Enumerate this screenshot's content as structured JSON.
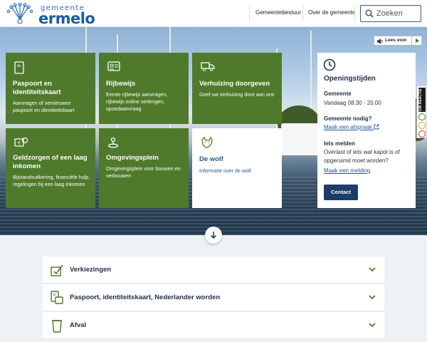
{
  "header": {
    "logo_top": "gemeente",
    "logo_main": "ermelo",
    "nav": [
      "Gemeentebestuur",
      "Over de gemeente"
    ],
    "search_placeholder": "Zoeken"
  },
  "hero": {
    "read_aloud": "Lees voor"
  },
  "tiles": [
    {
      "title": "Paspoort en identiteitskaart",
      "desc": "Aanvragen of vernieuwen paspoort en identiteitskaart",
      "icon": "passport-icon"
    },
    {
      "title": "Rijbewijs",
      "desc": "Eerste rijbewijs aanvragen, rijbewijs online verlengen, spoedaanvraag",
      "icon": "id-card-icon"
    },
    {
      "title": "Verhuizing doorgeven",
      "desc": "Geef uw verhuizing door aan ons",
      "icon": "truck-icon"
    },
    {
      "title": "Geldzorgen of een laag inkomen",
      "desc": "Bijstandsuitkering, financiële hulp, regelingen bij een laag inkomen",
      "icon": "money-icon"
    },
    {
      "title": "Omgevingsplein",
      "desc": "Omgevingsplein voor bouwen en verbouwen",
      "icon": "location-icon"
    },
    {
      "title": "De wolf",
      "desc": "Informatie over de wolf",
      "icon": "wolf-icon"
    }
  ],
  "opening": {
    "title": "Openingstijden",
    "gemeente_label": "Gemeente",
    "gemeente_hours": "Vandaag 08.30 - 20.00",
    "nodig_label": "Gemeente nodig?",
    "afspraak_link": "Maak een afspraak",
    "melden_label": "Iets melden",
    "melden_text": "Overlast of iets wat kapot is of opgeruimd moet worden?",
    "melding_link": "Maak een melding",
    "contact_button": "Contact"
  },
  "feedback": {
    "label": "UW REACTIE"
  },
  "accordion": [
    {
      "label": "Verkiezingen",
      "icon": "ballot-icon"
    },
    {
      "label": "Paspoort, identiteitskaart, Nederlander worden",
      "icon": "passport-icon"
    },
    {
      "label": "Afval",
      "icon": "bin-icon"
    }
  ],
  "colors": {
    "tile_green": "#4f7a2b",
    "brand_blue": "#1f5a98",
    "contact_navy": "#1b3d66"
  }
}
